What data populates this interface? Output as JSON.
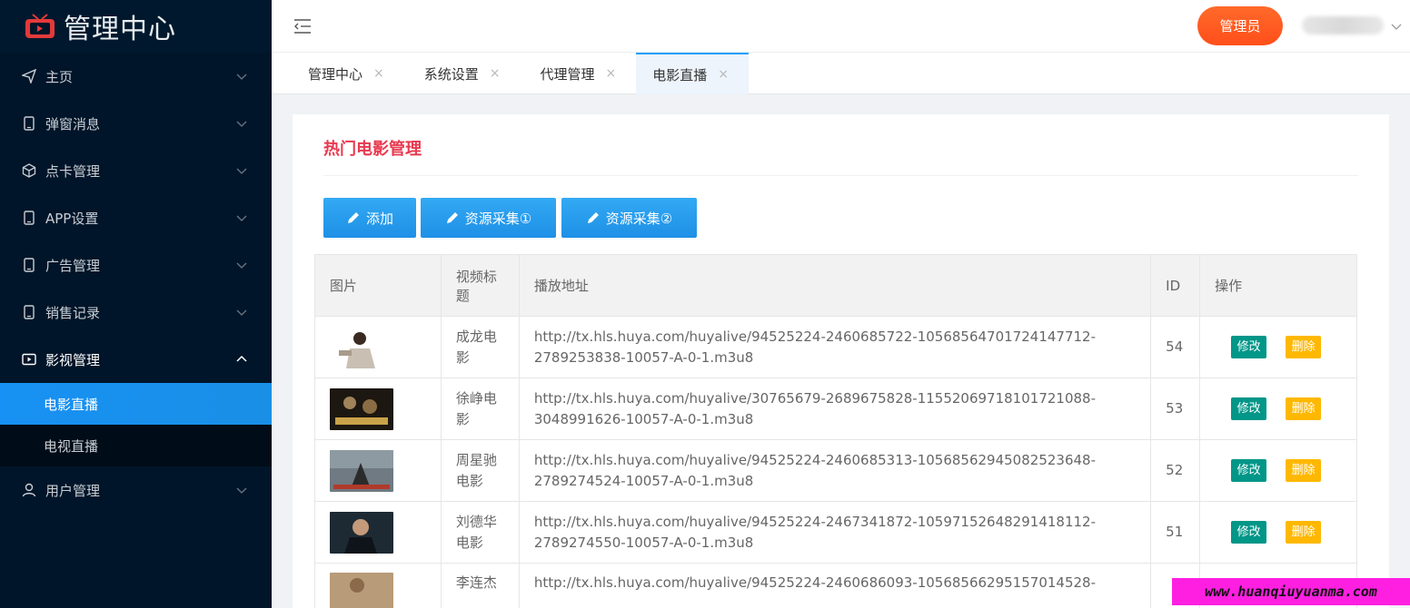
{
  "app": {
    "title": "管理中心"
  },
  "sidebar": {
    "items": [
      {
        "label": "主页",
        "icon": "paper-plane-icon"
      },
      {
        "label": "弹窗消息",
        "icon": "tablet-icon"
      },
      {
        "label": "点卡管理",
        "icon": "cube-icon"
      },
      {
        "label": "APP设置",
        "icon": "tablet-icon"
      },
      {
        "label": "广告管理",
        "icon": "tablet-icon"
      },
      {
        "label": "销售记录",
        "icon": "tablet-icon"
      },
      {
        "label": "影视管理",
        "icon": "video-icon",
        "open": true
      },
      {
        "label": "用户管理",
        "icon": "user-icon"
      }
    ],
    "sub_items": [
      {
        "label": "电影直播",
        "active": true
      },
      {
        "label": "电视直播",
        "active": false
      }
    ]
  },
  "header": {
    "admin_label": "管理员"
  },
  "tabs": [
    {
      "label": "管理中心"
    },
    {
      "label": "系统设置"
    },
    {
      "label": "代理管理"
    },
    {
      "label": "电影直播",
      "active": true
    }
  ],
  "tab_close_glyph": "×",
  "main": {
    "title": "热门电影管理",
    "buttons": {
      "add": "添加",
      "collect1": "资源采集①",
      "collect2": "资源采集②"
    },
    "table": {
      "headers": [
        "图片",
        "视频标题",
        "播放地址",
        "ID",
        "操作"
      ],
      "rows": [
        {
          "title": "成龙电影",
          "url": "http://tx.hls.huya.com/huyalive/94525224-2460685722-10568564701724147712-2789253838-10057-A-0-1.m3u8",
          "id": "54"
        },
        {
          "title": "徐峥电影",
          "url": "http://tx.hls.huya.com/huyalive/30765679-2689675828-11552069718101721088-3048991626-10057-A-0-1.m3u8",
          "id": "53"
        },
        {
          "title": "周星驰电影",
          "url": "http://tx.hls.huya.com/huyalive/94525224-2460685313-10568562945082523648-2789274524-10057-A-0-1.m3u8",
          "id": "52"
        },
        {
          "title": "刘德华电影",
          "url": "http://tx.hls.huya.com/huyalive/94525224-2467341872-10597152648291418112-2789274550-10057-A-0-1.m3u8",
          "id": "51"
        },
        {
          "title": "李连杰",
          "url": "http://tx.hls.huya.com/huyalive/94525224-2460686093-10568566295157014528-",
          "id": ""
        }
      ],
      "edit_label": "修改",
      "delete_label": "删除"
    }
  },
  "watermark": "www.huanqiuyuanma.com",
  "colors": {
    "sidebar_bg": "#001529",
    "accent_blue": "#1e9fff",
    "title_red": "#e8394f",
    "admin_orange": "#ff5722",
    "edit_green": "#009688",
    "delete_yellow": "#ffb800"
  }
}
